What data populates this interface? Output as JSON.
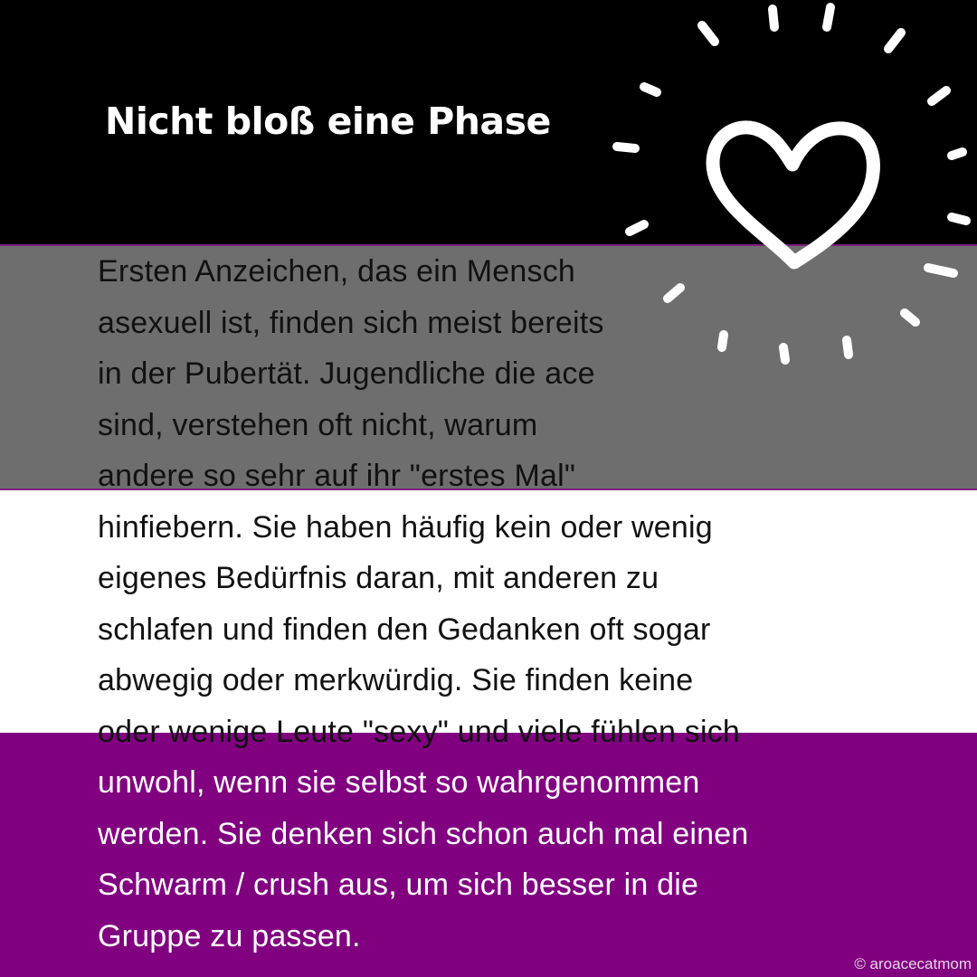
{
  "title": "Nicht bloß eine Phase",
  "body_lines": [
    "Ersten Anzeichen, das ein Mensch",
    "asexuell ist, finden sich meist bereits",
    "in der Pubertät. Jugendliche die ace",
    "sind, verstehen oft nicht, warum",
    "andere so sehr auf ihr \"erstes Mal\"",
    "hinfiebern. Sie haben häufig kein oder wenig",
    "eigenes Bedürfnis daran, mit anderen zu",
    "schlafen und finden den Gedanken oft sogar",
    "abwegig oder merkwürdig. Sie finden keine",
    "oder wenige Leute \"sexy\" und viele fühlen sich",
    "unwohl, wenn sie selbst so wahrgenommen",
    "werden. Sie denken sich schon auch mal einen",
    "Schwarm / crush aus, um sich besser in die",
    "Gruppe zu passen."
  ],
  "copyright": "© aroacecatmom",
  "icons": {
    "decoration": "heart-burst-icon"
  },
  "colors": {
    "stripe_black": "#000000",
    "stripe_grey": "#6e6e6e",
    "stripe_white": "#ffffff",
    "stripe_purple": "#800080"
  }
}
